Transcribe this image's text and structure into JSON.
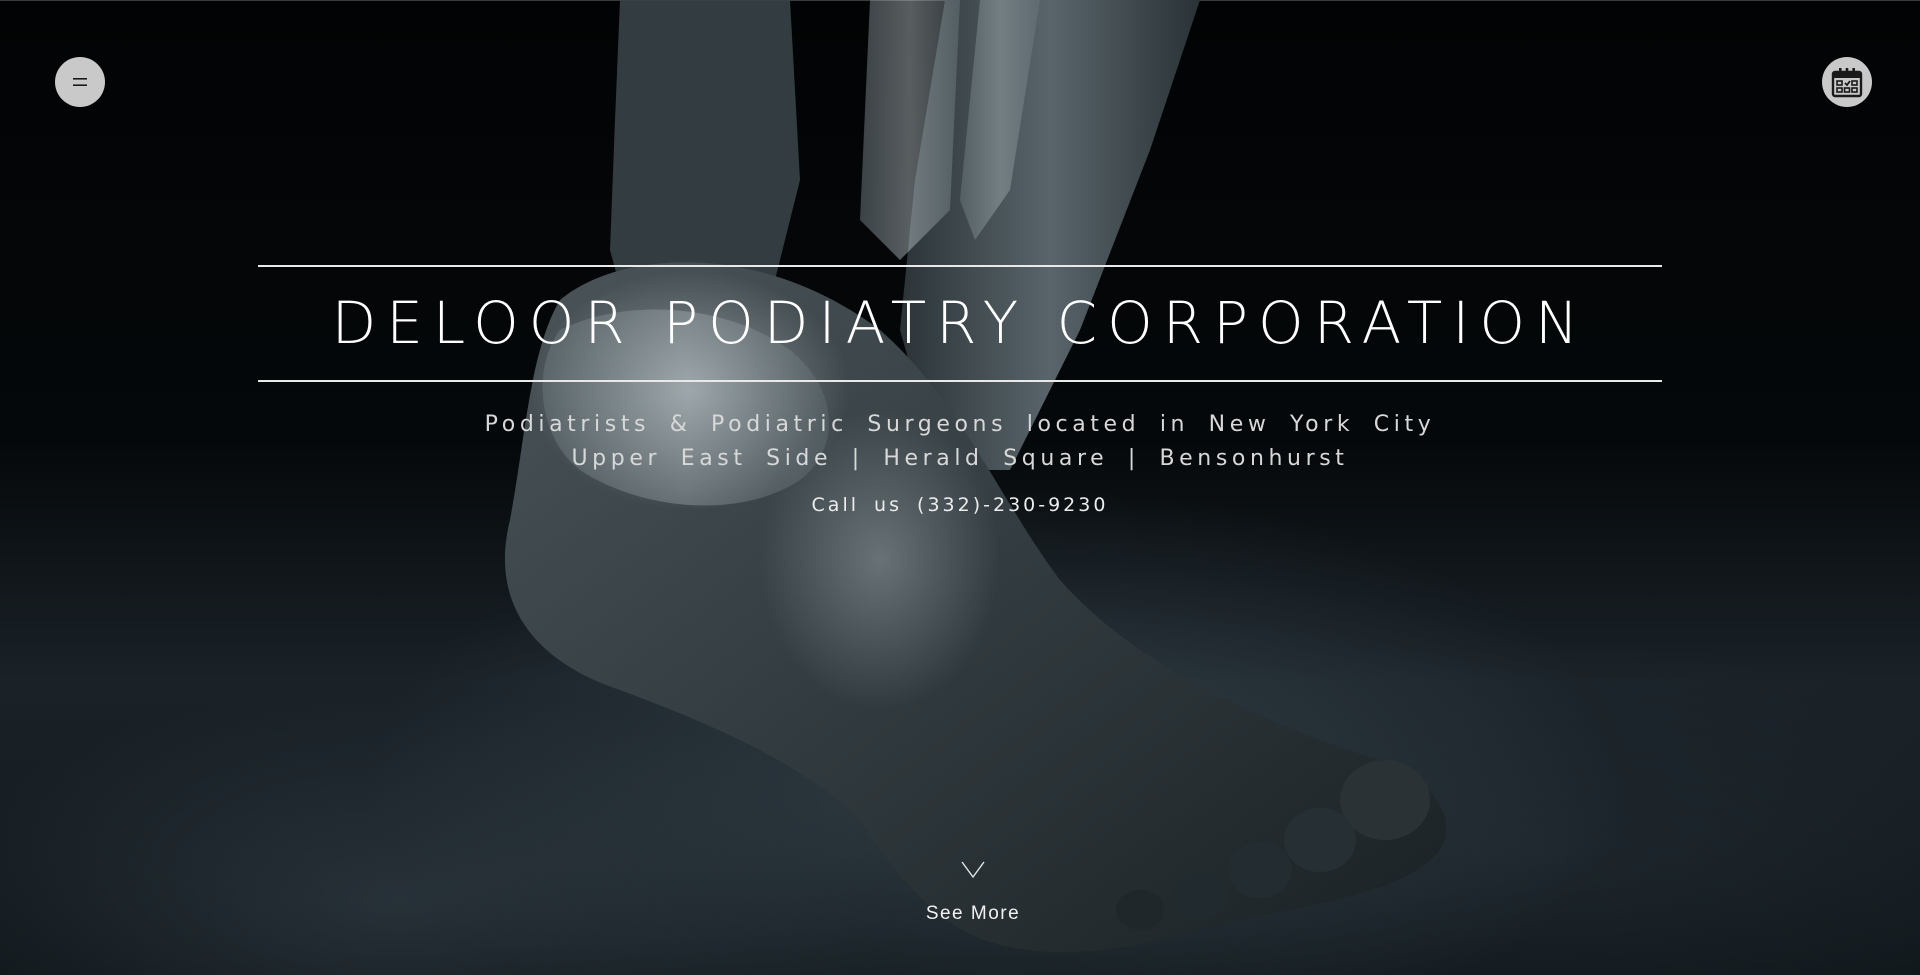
{
  "header": {
    "menu_icon": "menu-icon",
    "calendar_icon": "calendar-icon"
  },
  "hero": {
    "title": "DELOOR PODIATRY CORPORATION",
    "subtitle_line1": "Podiatrists & Podiatric Surgeons located in New York City",
    "subtitle_line2": "Upper East Side | Herald Square | Bensonhurst",
    "phone_prefix": "Call us",
    "phone_number": "(332)-230-9230",
    "see_more_label": "See More",
    "see_more_icon": "chevron-down-icon",
    "background_image": "foot-xray-photo"
  },
  "colors": {
    "background": "#000000",
    "text": "#ffffff",
    "button_bg": "#c9c9c9",
    "rule": "#e9e9e9"
  }
}
